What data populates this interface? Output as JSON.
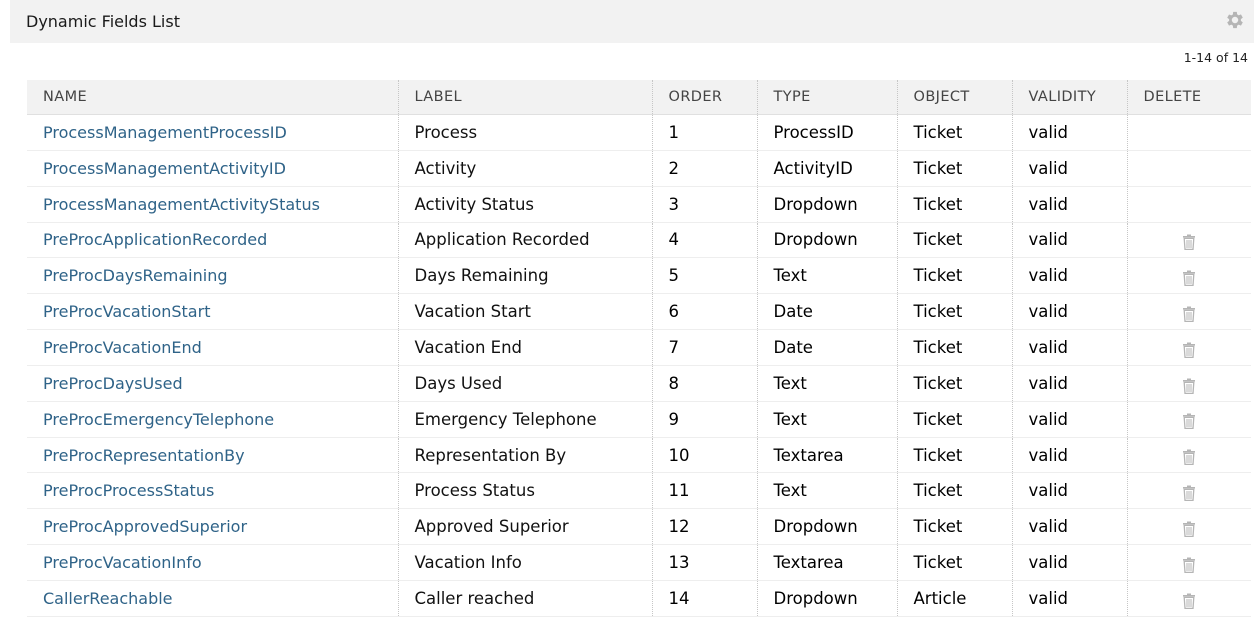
{
  "header": {
    "title": "Dynamic Fields List"
  },
  "pagination": {
    "text": "1-14 of 14"
  },
  "table": {
    "columns": [
      "NAME",
      "LABEL",
      "ORDER",
      "TYPE",
      "OBJECT",
      "VALIDITY",
      "DELETE"
    ],
    "rows": [
      {
        "name": "ProcessManagementProcessID",
        "label": "Process",
        "order": "1",
        "type": "ProcessID",
        "object": "Ticket",
        "validity": "valid",
        "deletable": false
      },
      {
        "name": "ProcessManagementActivityID",
        "label": "Activity",
        "order": "2",
        "type": "ActivityID",
        "object": "Ticket",
        "validity": "valid",
        "deletable": false
      },
      {
        "name": "ProcessManagementActivityStatus",
        "label": "Activity Status",
        "order": "3",
        "type": "Dropdown",
        "object": "Ticket",
        "validity": "valid",
        "deletable": false
      },
      {
        "name": "PreProcApplicationRecorded",
        "label": "Application Recorded",
        "order": "4",
        "type": "Dropdown",
        "object": "Ticket",
        "validity": "valid",
        "deletable": true
      },
      {
        "name": "PreProcDaysRemaining",
        "label": "Days Remaining",
        "order": "5",
        "type": "Text",
        "object": "Ticket",
        "validity": "valid",
        "deletable": true
      },
      {
        "name": "PreProcVacationStart",
        "label": "Vacation Start",
        "order": "6",
        "type": "Date",
        "object": "Ticket",
        "validity": "valid",
        "deletable": true
      },
      {
        "name": "PreProcVacationEnd",
        "label": "Vacation End",
        "order": "7",
        "type": "Date",
        "object": "Ticket",
        "validity": "valid",
        "deletable": true
      },
      {
        "name": "PreProcDaysUsed",
        "label": "Days Used",
        "order": "8",
        "type": "Text",
        "object": "Ticket",
        "validity": "valid",
        "deletable": true
      },
      {
        "name": "PreProcEmergencyTelephone",
        "label": "Emergency Telephone",
        "order": "9",
        "type": "Text",
        "object": "Ticket",
        "validity": "valid",
        "deletable": true
      },
      {
        "name": "PreProcRepresentationBy",
        "label": "Representation By",
        "order": "10",
        "type": "Textarea",
        "object": "Ticket",
        "validity": "valid",
        "deletable": true
      },
      {
        "name": "PreProcProcessStatus",
        "label": "Process Status",
        "order": "11",
        "type": "Text",
        "object": "Ticket",
        "validity": "valid",
        "deletable": true
      },
      {
        "name": "PreProcApprovedSuperior",
        "label": "Approved Superior",
        "order": "12",
        "type": "Dropdown",
        "object": "Ticket",
        "validity": "valid",
        "deletable": true
      },
      {
        "name": "PreProcVacationInfo",
        "label": "Vacation Info",
        "order": "13",
        "type": "Textarea",
        "object": "Ticket",
        "validity": "valid",
        "deletable": true
      },
      {
        "name": "CallerReachable",
        "label": "Caller reached",
        "order": "14",
        "type": "Dropdown",
        "object": "Article",
        "validity": "valid",
        "deletable": true
      }
    ]
  },
  "icons": {
    "settings": "gear-icon",
    "delete": "trash-icon"
  },
  "colors": {
    "link": "#2f6388",
    "header_bg": "#f2f2f2",
    "icon": "#b5b5b5"
  }
}
